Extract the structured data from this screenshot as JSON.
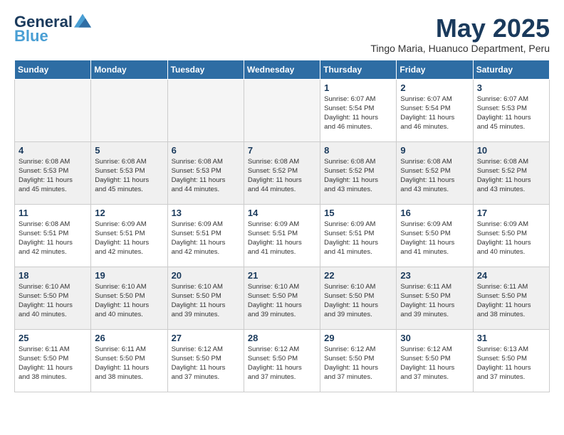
{
  "header": {
    "logo_line1": "General",
    "logo_line2": "Blue",
    "month_title": "May 2025",
    "subtitle": "Tingo Maria, Huanuco Department, Peru"
  },
  "weekdays": [
    "Sunday",
    "Monday",
    "Tuesday",
    "Wednesday",
    "Thursday",
    "Friday",
    "Saturday"
  ],
  "weeks": [
    [
      {
        "day": "",
        "info": ""
      },
      {
        "day": "",
        "info": ""
      },
      {
        "day": "",
        "info": ""
      },
      {
        "day": "",
        "info": ""
      },
      {
        "day": "1",
        "info": "Sunrise: 6:07 AM\nSunset: 5:54 PM\nDaylight: 11 hours\nand 46 minutes."
      },
      {
        "day": "2",
        "info": "Sunrise: 6:07 AM\nSunset: 5:54 PM\nDaylight: 11 hours\nand 46 minutes."
      },
      {
        "day": "3",
        "info": "Sunrise: 6:07 AM\nSunset: 5:53 PM\nDaylight: 11 hours\nand 45 minutes."
      }
    ],
    [
      {
        "day": "4",
        "info": "Sunrise: 6:08 AM\nSunset: 5:53 PM\nDaylight: 11 hours\nand 45 minutes."
      },
      {
        "day": "5",
        "info": "Sunrise: 6:08 AM\nSunset: 5:53 PM\nDaylight: 11 hours\nand 45 minutes."
      },
      {
        "day": "6",
        "info": "Sunrise: 6:08 AM\nSunset: 5:53 PM\nDaylight: 11 hours\nand 44 minutes."
      },
      {
        "day": "7",
        "info": "Sunrise: 6:08 AM\nSunset: 5:52 PM\nDaylight: 11 hours\nand 44 minutes."
      },
      {
        "day": "8",
        "info": "Sunrise: 6:08 AM\nSunset: 5:52 PM\nDaylight: 11 hours\nand 43 minutes."
      },
      {
        "day": "9",
        "info": "Sunrise: 6:08 AM\nSunset: 5:52 PM\nDaylight: 11 hours\nand 43 minutes."
      },
      {
        "day": "10",
        "info": "Sunrise: 6:08 AM\nSunset: 5:52 PM\nDaylight: 11 hours\nand 43 minutes."
      }
    ],
    [
      {
        "day": "11",
        "info": "Sunrise: 6:08 AM\nSunset: 5:51 PM\nDaylight: 11 hours\nand 42 minutes."
      },
      {
        "day": "12",
        "info": "Sunrise: 6:09 AM\nSunset: 5:51 PM\nDaylight: 11 hours\nand 42 minutes."
      },
      {
        "day": "13",
        "info": "Sunrise: 6:09 AM\nSunset: 5:51 PM\nDaylight: 11 hours\nand 42 minutes."
      },
      {
        "day": "14",
        "info": "Sunrise: 6:09 AM\nSunset: 5:51 PM\nDaylight: 11 hours\nand 41 minutes."
      },
      {
        "day": "15",
        "info": "Sunrise: 6:09 AM\nSunset: 5:51 PM\nDaylight: 11 hours\nand 41 minutes."
      },
      {
        "day": "16",
        "info": "Sunrise: 6:09 AM\nSunset: 5:50 PM\nDaylight: 11 hours\nand 41 minutes."
      },
      {
        "day": "17",
        "info": "Sunrise: 6:09 AM\nSunset: 5:50 PM\nDaylight: 11 hours\nand 40 minutes."
      }
    ],
    [
      {
        "day": "18",
        "info": "Sunrise: 6:10 AM\nSunset: 5:50 PM\nDaylight: 11 hours\nand 40 minutes."
      },
      {
        "day": "19",
        "info": "Sunrise: 6:10 AM\nSunset: 5:50 PM\nDaylight: 11 hours\nand 40 minutes."
      },
      {
        "day": "20",
        "info": "Sunrise: 6:10 AM\nSunset: 5:50 PM\nDaylight: 11 hours\nand 39 minutes."
      },
      {
        "day": "21",
        "info": "Sunrise: 6:10 AM\nSunset: 5:50 PM\nDaylight: 11 hours\nand 39 minutes."
      },
      {
        "day": "22",
        "info": "Sunrise: 6:10 AM\nSunset: 5:50 PM\nDaylight: 11 hours\nand 39 minutes."
      },
      {
        "day": "23",
        "info": "Sunrise: 6:11 AM\nSunset: 5:50 PM\nDaylight: 11 hours\nand 39 minutes."
      },
      {
        "day": "24",
        "info": "Sunrise: 6:11 AM\nSunset: 5:50 PM\nDaylight: 11 hours\nand 38 minutes."
      }
    ],
    [
      {
        "day": "25",
        "info": "Sunrise: 6:11 AM\nSunset: 5:50 PM\nDaylight: 11 hours\nand 38 minutes."
      },
      {
        "day": "26",
        "info": "Sunrise: 6:11 AM\nSunset: 5:50 PM\nDaylight: 11 hours\nand 38 minutes."
      },
      {
        "day": "27",
        "info": "Sunrise: 6:12 AM\nSunset: 5:50 PM\nDaylight: 11 hours\nand 37 minutes."
      },
      {
        "day": "28",
        "info": "Sunrise: 6:12 AM\nSunset: 5:50 PM\nDaylight: 11 hours\nand 37 minutes."
      },
      {
        "day": "29",
        "info": "Sunrise: 6:12 AM\nSunset: 5:50 PM\nDaylight: 11 hours\nand 37 minutes."
      },
      {
        "day": "30",
        "info": "Sunrise: 6:12 AM\nSunset: 5:50 PM\nDaylight: 11 hours\nand 37 minutes."
      },
      {
        "day": "31",
        "info": "Sunrise: 6:13 AM\nSunset: 5:50 PM\nDaylight: 11 hours\nand 37 minutes."
      }
    ]
  ]
}
